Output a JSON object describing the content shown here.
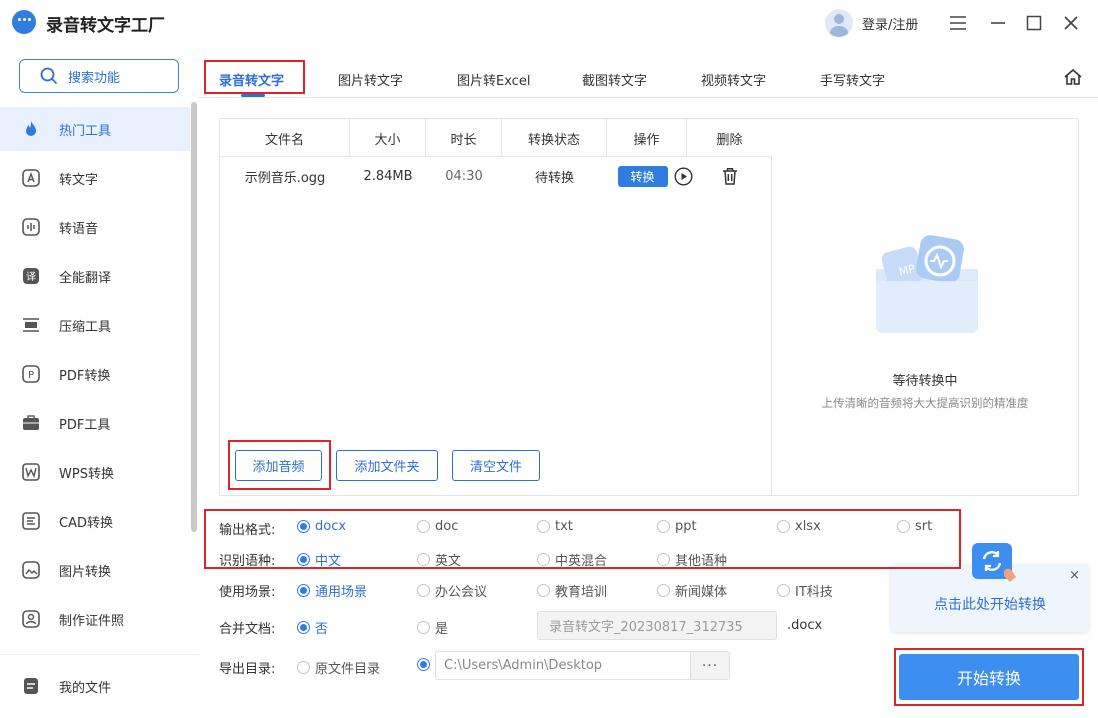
{
  "app": {
    "title": "录音转文字工厂",
    "login": "登录/注册"
  },
  "sidebar": {
    "search": "搜索功能",
    "items": [
      {
        "label": "热门工具",
        "icon": "flame-icon",
        "active": true
      },
      {
        "label": "转文字",
        "icon": "text-convert-icon"
      },
      {
        "label": "转语音",
        "icon": "voice-icon"
      },
      {
        "label": "全能翻译",
        "icon": "translate-icon"
      },
      {
        "label": "压缩工具",
        "icon": "compress-icon"
      },
      {
        "label": "PDF转换",
        "icon": "pdf-convert-icon"
      },
      {
        "label": "PDF工具",
        "icon": "pdf-tools-icon"
      },
      {
        "label": "WPS转换",
        "icon": "wps-icon"
      },
      {
        "label": "CAD转换",
        "icon": "cad-icon"
      },
      {
        "label": "图片转换",
        "icon": "image-convert-icon"
      },
      {
        "label": "制作证件照",
        "icon": "id-photo-icon"
      }
    ],
    "my_files": "我的文件"
  },
  "tabs": [
    "录音转文字",
    "图片转文字",
    "图片转Excel",
    "截图转文字",
    "视频转文字",
    "手写转文字"
  ],
  "table": {
    "headers": [
      "文件名",
      "大小",
      "时长",
      "转换状态",
      "操作",
      "删除"
    ],
    "rows": [
      {
        "name": "示例音乐.ogg",
        "size": "2.84MB",
        "duration": "04:30",
        "status": "待转换",
        "action": "转换"
      }
    ]
  },
  "buttons": {
    "add_audio": "添加音频",
    "add_folder": "添加文件夹",
    "clear": "清空文件"
  },
  "preview": {
    "title": "等待转换中",
    "subtitle": "上传清晰的音频将大大提高识别的精准度"
  },
  "options": {
    "format_label": "输出格式:",
    "formats": [
      "docx",
      "doc",
      "txt",
      "ppt",
      "xlsx",
      "srt"
    ],
    "lang_label": "识别语种:",
    "langs": [
      "中文",
      "英文",
      "中英混合",
      "其他语种"
    ],
    "scene_label": "使用场景:",
    "scenes": [
      "通用场景",
      "办公会议",
      "教育培训",
      "新闻媒体",
      "IT科技"
    ],
    "merge_label": "合并文档:",
    "merge_no": "否",
    "merge_yes": "是",
    "merge_name": "录音转文字_20230817_312735",
    "merge_ext": ".docx",
    "export_label": "导出目录:",
    "export_original": "原文件目录",
    "export_path": "C:\\Users\\Admin\\Desktop",
    "browse": "···"
  },
  "tooltip": {
    "text": "点击此处开始转换",
    "close": "×"
  },
  "start_button": "开始转换",
  "colors": {
    "accent": "#2f7de1",
    "highlight": "#d9262b"
  }
}
